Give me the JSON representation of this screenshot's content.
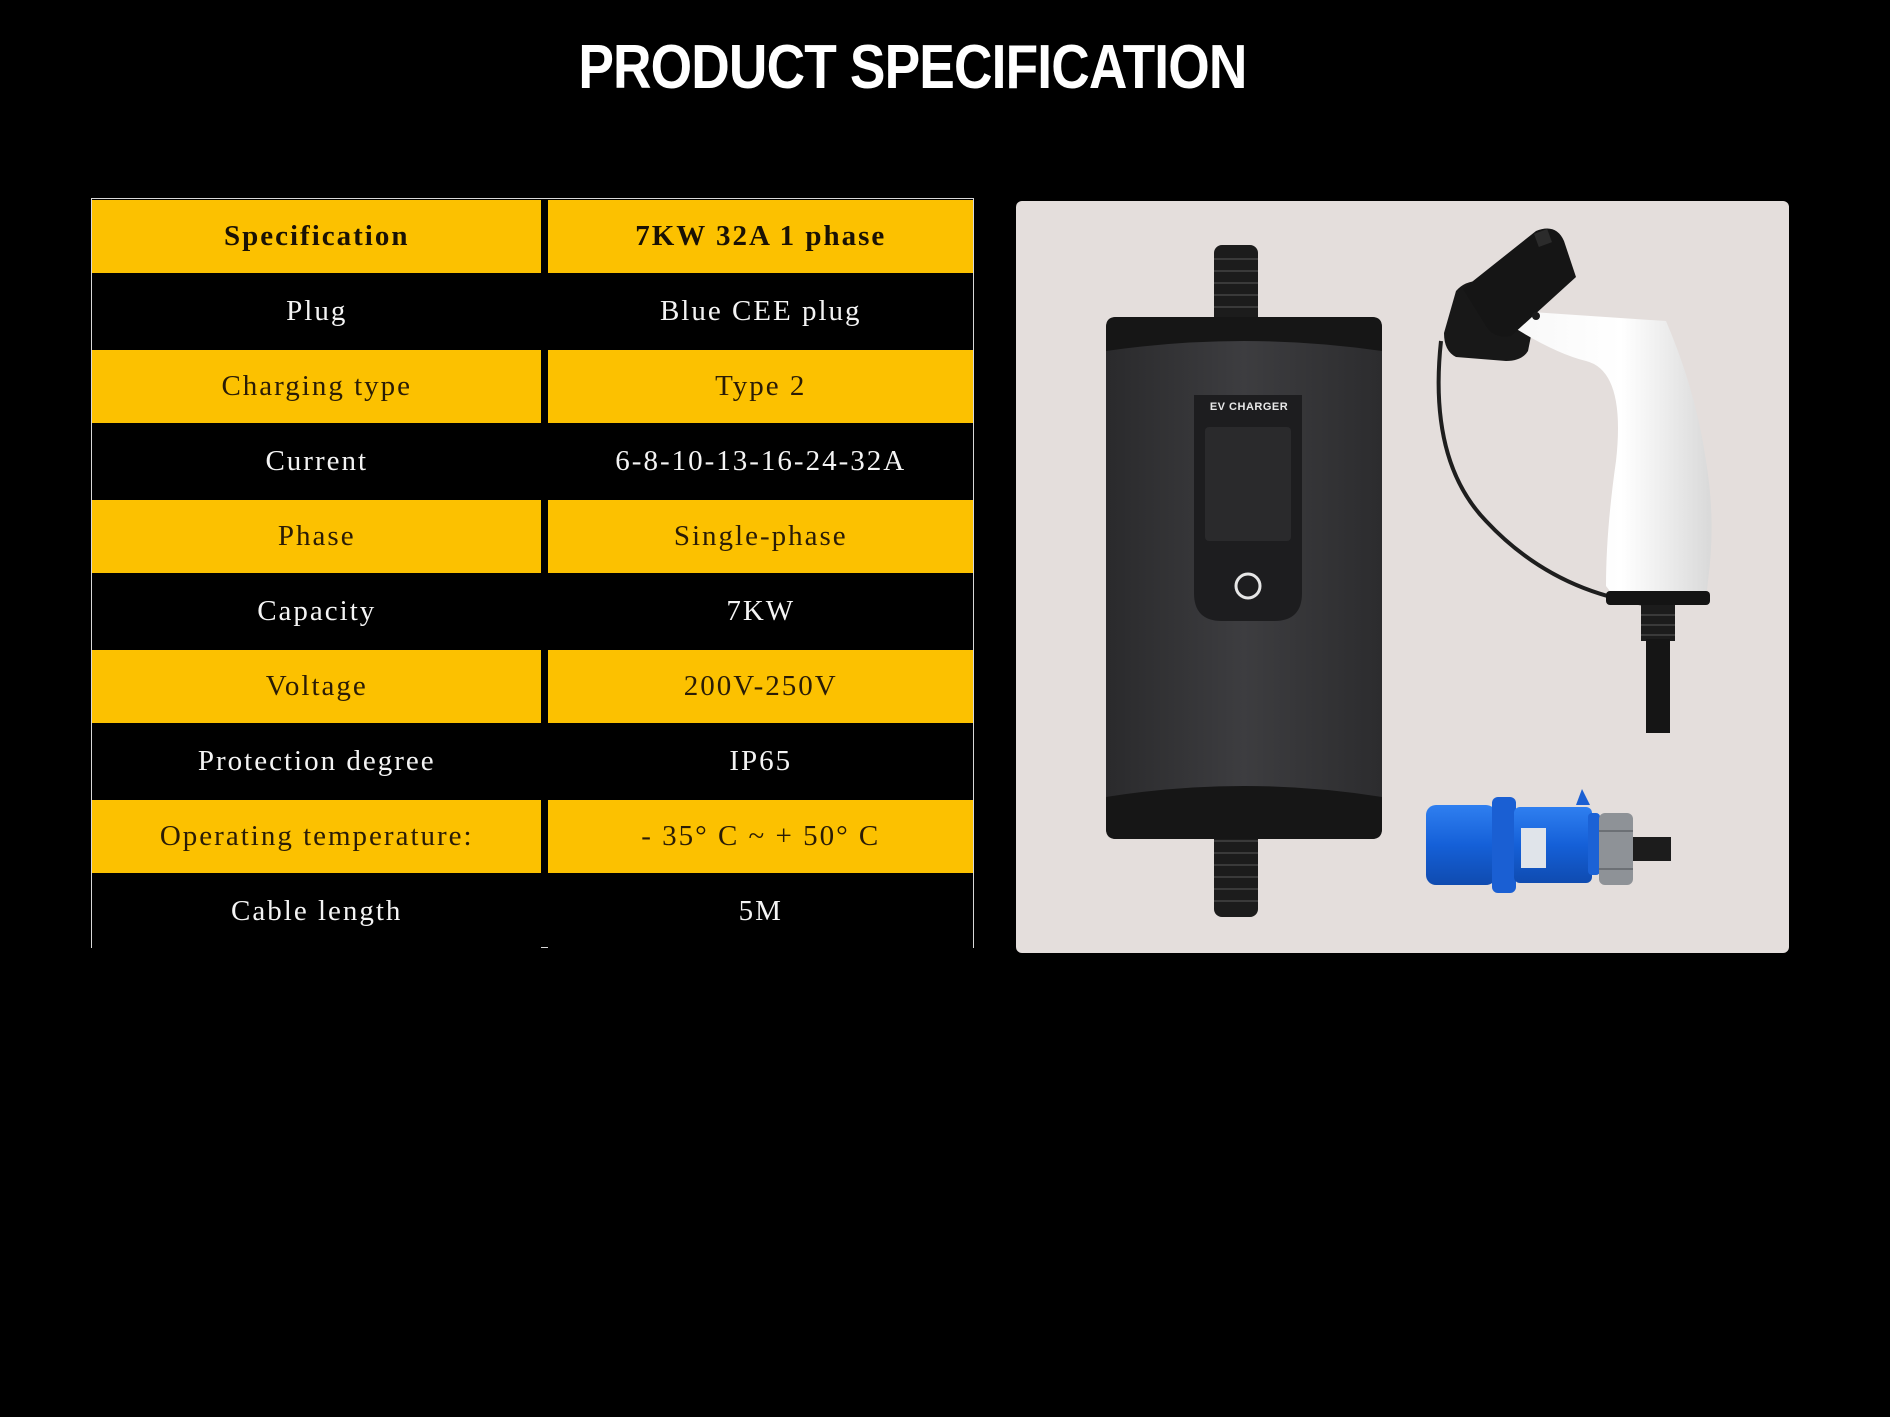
{
  "page": {
    "title": "PRODUCT SPECIFICATION"
  },
  "spec_table": {
    "header": {
      "key": "Specification",
      "value": "7KW 32A 1 phase"
    },
    "rows": [
      {
        "key": "Plug",
        "value": "Blue CEE plug"
      },
      {
        "key": "Charging type",
        "value": "Type 2"
      },
      {
        "key": "Current",
        "value": "6-8-10-13-16-24-32A"
      },
      {
        "key": "Phase",
        "value": "Single-phase"
      },
      {
        "key": "Capacity",
        "value": "7KW"
      },
      {
        "key": "Voltage",
        "value": "200V-250V"
      },
      {
        "key": "Protection degree",
        "value": "IP65"
      },
      {
        "key": "Operating temperature:",
        "value": "- 35° C ~ + 50° C"
      },
      {
        "key": "Cable length",
        "value": "5M"
      }
    ],
    "colors": {
      "gold": "#fcc100",
      "dark": "#000000"
    }
  },
  "product_image": {
    "device_label": "EV CHARGER",
    "items": [
      "ev-charger-control-box",
      "type2-connector",
      "connector-dust-cap",
      "blue-cee-plug"
    ]
  }
}
